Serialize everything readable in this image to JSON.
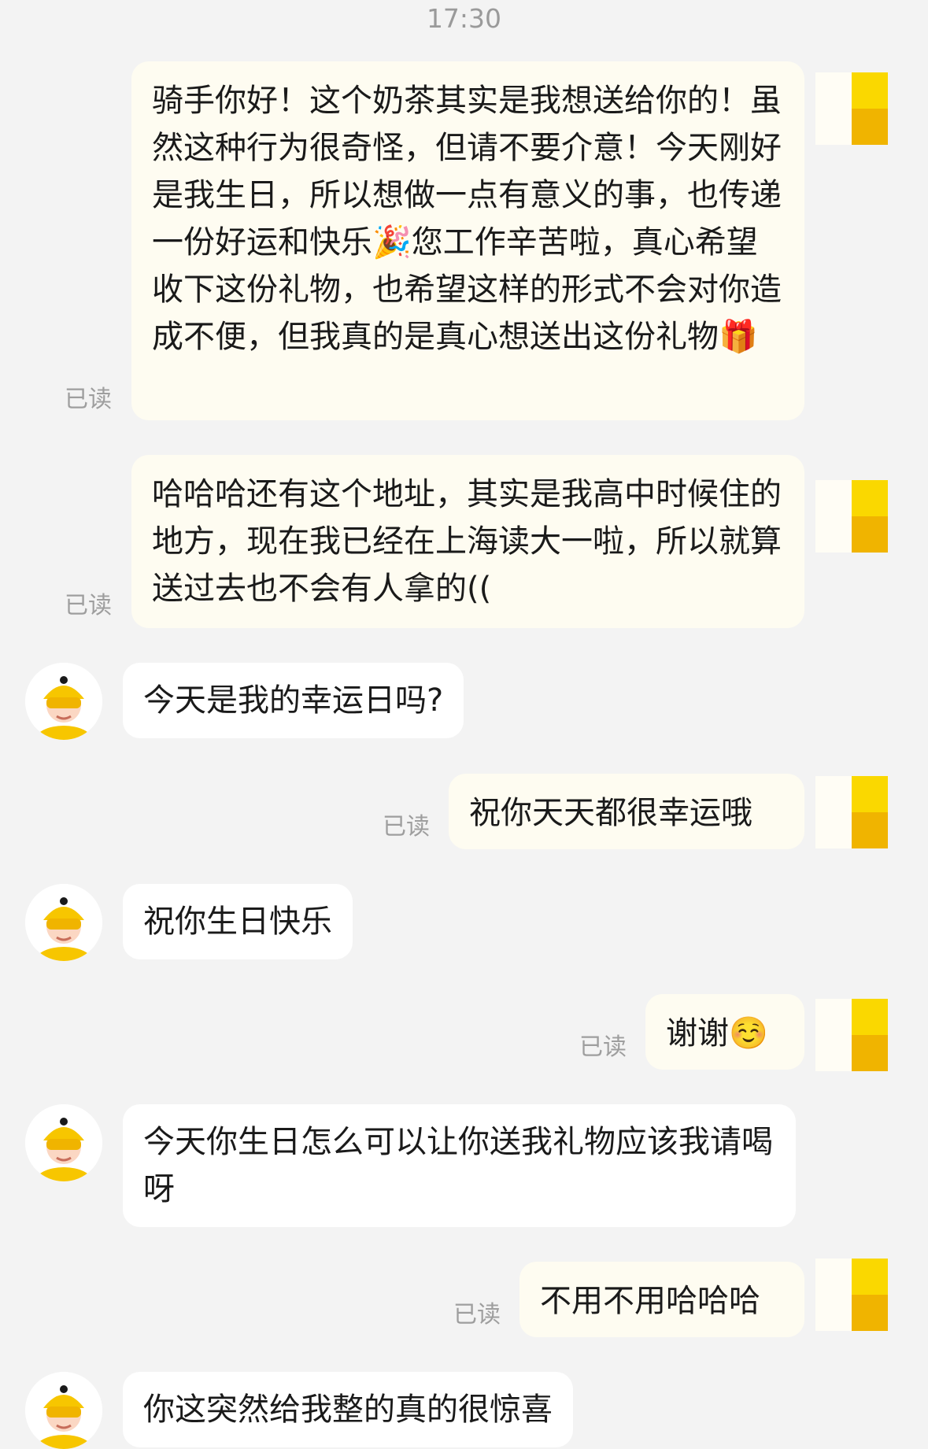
{
  "header": {
    "time": "17:30"
  },
  "messages": [
    {
      "from": "self",
      "text": "骑手你好！这个奶茶其实是我想送给你的！虽然这种行为很奇怪，但请不要介意！今天刚好是我生日，所以想做一点有意义的事，也传递一份好运和快乐🎉您工作辛苦啦，真心希望收下这份礼物，也希望这样的形式不会对你造成不便，但我真的是真心想送出这份礼物🎁",
      "status": "已读"
    },
    {
      "from": "self",
      "text": "哈哈哈还有这个地址，其实是我高中时候住的地方，现在我已经在上海读大一啦，所以就算送过去也不会有人拿的((",
      "status": "已读"
    },
    {
      "from": "other",
      "text": "今天是我的幸运日吗?"
    },
    {
      "from": "self",
      "text": "祝你天天都很幸运哦",
      "status": "已读"
    },
    {
      "from": "other",
      "text": "祝你生日快乐"
    },
    {
      "from": "self",
      "text": "谢谢☺️",
      "status": "已读"
    },
    {
      "from": "other",
      "text": "今天你生日怎么可以让你送我礼物应该我请喝呀"
    },
    {
      "from": "self",
      "text": "不用不用哈哈哈",
      "status": "已读"
    },
    {
      "from": "other",
      "text": "你这突然给我整的真的很惊喜"
    }
  ],
  "colors": {
    "background": "#f3f3f3",
    "self_bubble": "#fefcf1",
    "other_bubble": "#ffffff",
    "avatar_helmet": "#f7c600",
    "read_status": "#9e9e9e"
  },
  "icons": {
    "other_avatar": "rider-avatar-icon",
    "self_avatar": "user-avatar-icon"
  }
}
